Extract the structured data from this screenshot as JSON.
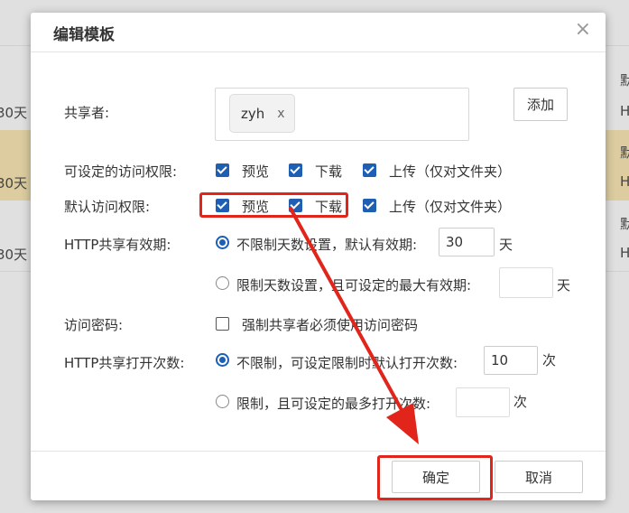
{
  "background": {
    "left_col": [
      "30天",
      "30天",
      "30天"
    ],
    "right_col": [
      [
        "默",
        "H"
      ],
      [
        "默",
        "H"
      ],
      [
        "默",
        "H"
      ]
    ]
  },
  "dialog": {
    "title": "编辑模板",
    "close_glyph": "×"
  },
  "sharer": {
    "label": "共享者:",
    "tag": "zyh",
    "tag_remove": "x",
    "add_label": "添加"
  },
  "permissions": {
    "settable_label": "可设定的访问权限:",
    "settable": {
      "preview": {
        "label": "预览",
        "checked": true
      },
      "download": {
        "label": "下载",
        "checked": true
      },
      "upload": {
        "label": "上传（仅对文件夹）",
        "checked": true
      }
    },
    "default_label": "默认访问权限:",
    "default": {
      "preview": {
        "label": "预览",
        "checked": true
      },
      "download": {
        "label": "下载",
        "checked": true
      },
      "upload": {
        "label": "上传（仅对文件夹）",
        "checked": true
      }
    }
  },
  "validity": {
    "label": "HTTP共享有效期:",
    "opt_unlimited": "不限制天数设置，默认有效期:",
    "unlimited_value": "30",
    "unit": "天",
    "opt_limited": "限制天数设置，且可设定的最大有效期:",
    "limited_value": "",
    "selected": "unlimited"
  },
  "password": {
    "label": "访问密码:",
    "force_label": "强制共享者必须使用访问密码",
    "checked": false
  },
  "open_count": {
    "label": "HTTP共享打开次数:",
    "opt_unlimited": "不限制，可设定限制时默认打开次数:",
    "unlimited_value": "10",
    "unit": "次",
    "opt_limited": "限制，且可设定的最多打开次数:",
    "limited_value": "",
    "selected": "unlimited"
  },
  "footer": {
    "confirm_label": "确定",
    "cancel_label": "取消"
  },
  "colors": {
    "accent": "#1e5fb4",
    "highlight": "#e1251b"
  }
}
